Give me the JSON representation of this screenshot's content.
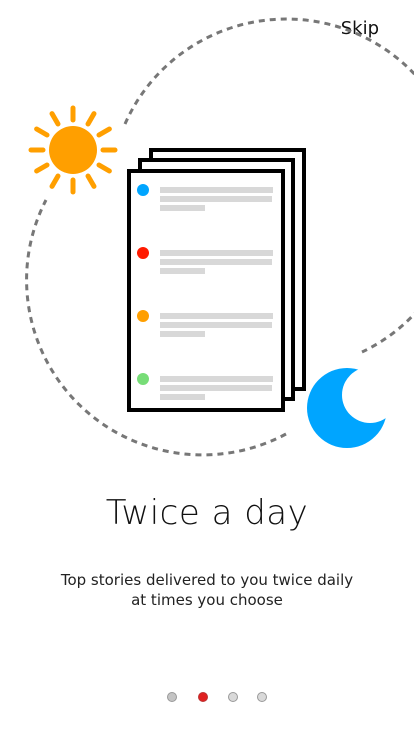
{
  "header": {
    "skip_label": "Skip"
  },
  "onboarding": {
    "title": "Twice a day",
    "subtitle": "Top stories delivered to you twice daily at times you choose"
  },
  "illustration": {
    "sun_color": "#FF9F00",
    "moon_color": "#00A5FF",
    "story_dot_colors": [
      "#00A5FF",
      "#FF1A00",
      "#FF9F00",
      "#77DD77"
    ]
  },
  "pagination": {
    "pages": 4,
    "current_page": 2,
    "active_color": "#E02020",
    "inactive_colors": [
      "#C4C4C4",
      "#D9D9D9",
      "#D9D9D9"
    ]
  }
}
